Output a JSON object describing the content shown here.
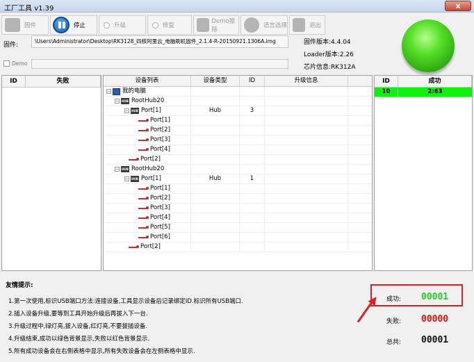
{
  "window": {
    "title": "工厂工具 v1.39",
    "close_label": "x"
  },
  "toolbar": {
    "firmware_label": "固件",
    "stop_label": "停止",
    "upgrade_label": "升级",
    "repair_label": "修复",
    "demo_erase_label": "Demo擦除",
    "language_label": "语言选择",
    "exit_label": "退出"
  },
  "firmware": {
    "label": "固件:",
    "path": "\\Users\\Administrator\\Desktop\\RK3128_四核阿里云_电脑刷机固件_2.1.4-R-20150921.1306A.img"
  },
  "demo": {
    "label": "Demo"
  },
  "info": {
    "fw_version": "固件版本:4.4.04",
    "loader_version": "Loader版本:2.26",
    "chip_info": "芯片信息:RK312A"
  },
  "fail_panel": {
    "col_id": "ID",
    "col_fail": "失败"
  },
  "tree": {
    "headers": [
      "设备列表",
      "设备类型",
      "ID",
      "升级信息"
    ],
    "rows": [
      {
        "label": "我的电脑",
        "type": "",
        "id": ""
      },
      {
        "label": "RootHub20",
        "type": "",
        "id": ""
      },
      {
        "label": "Port[1]",
        "type": "Hub",
        "id": "3"
      },
      {
        "label": "Port[1]",
        "type": "",
        "id": ""
      },
      {
        "label": "Port[2]",
        "type": "",
        "id": ""
      },
      {
        "label": "Port[3]",
        "type": "",
        "id": ""
      },
      {
        "label": "Port[4]",
        "type": "",
        "id": ""
      },
      {
        "label": "Port[2]",
        "type": "",
        "id": ""
      },
      {
        "label": "RootHub20",
        "type": "",
        "id": ""
      },
      {
        "label": "Port[1]",
        "type": "Hub",
        "id": "1"
      },
      {
        "label": "Port[1]",
        "type": "",
        "id": ""
      },
      {
        "label": "Port[2]",
        "type": "",
        "id": ""
      },
      {
        "label": "Port[3]",
        "type": "",
        "id": ""
      },
      {
        "label": "Port[4]",
        "type": "",
        "id": ""
      },
      {
        "label": "Port[5]",
        "type": "",
        "id": ""
      },
      {
        "label": "Port[6]",
        "type": "",
        "id": ""
      },
      {
        "label": "Port[2]",
        "type": "",
        "id": ""
      }
    ]
  },
  "success_panel": {
    "col_id": "ID",
    "col_success": "成功",
    "rows": [
      {
        "id": "10",
        "value": "2:63"
      }
    ]
  },
  "tips": {
    "title": "友情提示:",
    "items": [
      "1.第一次使用,标识USB端口方法:连接设备,工具显示设备后记录绑定ID.标识所有USB端口.",
      "2.插入设备升级,要等到工具开始升级后再拔入下一台.",
      "3.升级过程中,绿灯亮,拔入设备,红灯亮,不要拔插设备.",
      "4.升级结束,成功以绿色背景显示,失败以红色背景显示.",
      "5.所有成功设备会在右侧表格中显示,所有失败设备会在左侧表格中显示."
    ]
  },
  "stats": {
    "success_label": "成功:",
    "success_value": "00001",
    "success_color": "#22cc22",
    "fail_label": "失败:",
    "fail_value": "00000",
    "fail_color": "#e01010",
    "total_label": "总共:",
    "total_value": "00001",
    "total_color": "#111111"
  }
}
